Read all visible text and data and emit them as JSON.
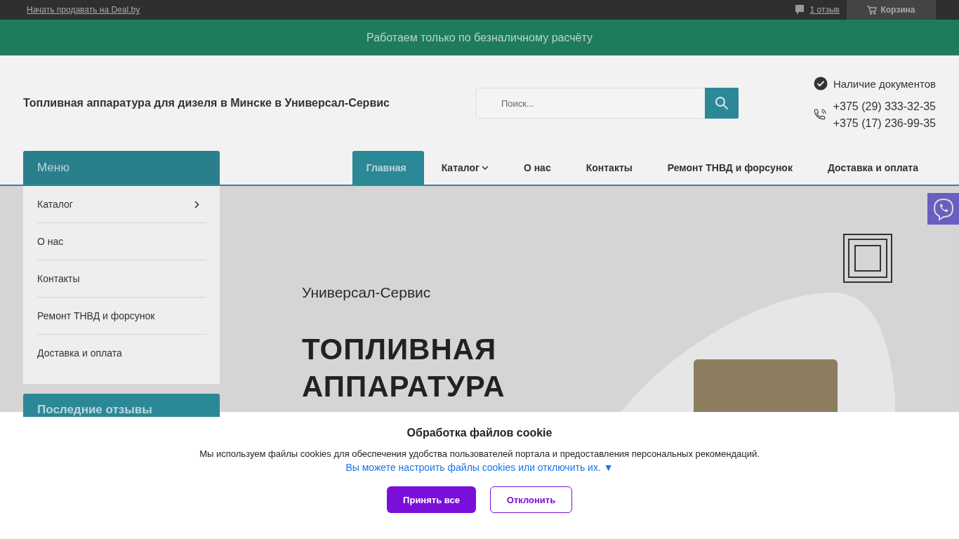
{
  "top_bar": {
    "sell_link": "Начать продавать на Deal.by",
    "reviews_link": "1 отзыв",
    "cart": "Корзина"
  },
  "banner": {
    "text": "Работаем только по безналичному расчёту"
  },
  "header": {
    "title": "Топливная аппаратура для дизеля в Минске в Универсал-Сервис",
    "search": {
      "placeholder": "Поиск..."
    },
    "documents": "Наличие документов",
    "phones": [
      "+375 (29) 333-32-35",
      "+375 (17) 236-99-35"
    ]
  },
  "nav": {
    "items": [
      {
        "label": "Главная",
        "selected": true,
        "kind": "link"
      },
      {
        "label": "Каталог",
        "selected": false,
        "kind": "dropdown"
      },
      {
        "label": "О нас",
        "selected": false,
        "kind": "link"
      },
      {
        "label": "Контакты",
        "selected": false,
        "kind": "link"
      },
      {
        "label": "Ремонт ТНВД и форсунок",
        "selected": false,
        "kind": "link"
      },
      {
        "label": "Доставка и оплата",
        "selected": false,
        "kind": "link"
      }
    ]
  },
  "sidebar": {
    "title": "Меню",
    "items": [
      {
        "label": "Каталог",
        "kind": "submenu"
      },
      {
        "label": "О нас",
        "kind": "link"
      },
      {
        "label": "Контакты",
        "kind": "link"
      },
      {
        "label": "Ремонт ТНВД и форсунок",
        "kind": "link"
      },
      {
        "label": "Доставка и оплата",
        "kind": "link"
      }
    ],
    "reviews_title": "Последние отзывы"
  },
  "hero": {
    "subtitle": "Универсал-Сервис",
    "heading": "ТОПЛИВНАЯ АППАРАТУРА"
  },
  "cookie_banner": {
    "title": "Обработка файлов cookie",
    "text": "Мы используем файлы cookies для обеспечения удобства пользователей портала и предоставления персональных рекомендаций.",
    "link": "Вы можете настроить файлы cookies или отключить их.",
    "link_arrow": "▼",
    "buttons": [
      {
        "label": "Принять все",
        "kind": "primary"
      },
      {
        "label": "Отклонить",
        "kind": "secondary"
      }
    ]
  }
}
